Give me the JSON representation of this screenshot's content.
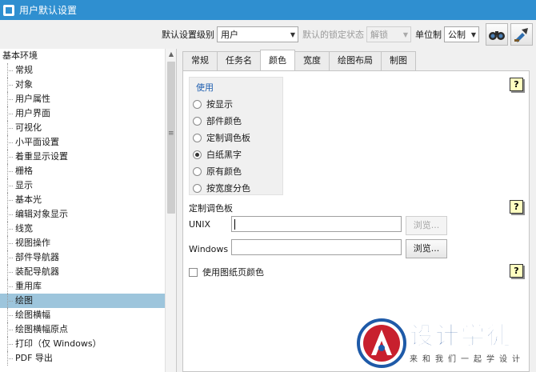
{
  "window": {
    "title": "用户默认设置"
  },
  "toolbar": {
    "level_label": "默认设置级别",
    "level_value": "用户",
    "lock_label": "默认的锁定状态",
    "lock_value": "解锁",
    "unit_label": "单位制",
    "unit_value": "公制",
    "buttons": [
      "binoculars-icon",
      "import-icon"
    ]
  },
  "tree": {
    "root": "基本环境",
    "items": [
      "常规",
      "对象",
      "用户属性",
      "用户界面",
      "可视化",
      "小平面设置",
      "着重显示设置",
      "栅格",
      "显示",
      "基本光",
      "编辑对象显示",
      "线宽",
      "视图操作",
      "部件导航器",
      "装配导航器",
      "重用库",
      "绘图",
      "绘图横幅",
      "绘图横幅原点",
      "打印（仅 Windows）",
      "PDF 导出"
    ],
    "selected": "绘图"
  },
  "tabs": [
    "常规",
    "任务名",
    "颜色",
    "宽度",
    "绘图布局",
    "制图"
  ],
  "active_tab": "颜色",
  "use_group": {
    "title": "使用",
    "options": [
      "按显示",
      "部件颜色",
      "定制调色板",
      "白纸黑字",
      "原有颜色",
      "按宽度分色"
    ],
    "selected": "白纸黑字"
  },
  "palette": {
    "title": "定制调色板",
    "unix_label": "UNIX",
    "unix_value": "",
    "windows_label": "Windows",
    "windows_value": "",
    "browse_label": "浏览..."
  },
  "checkbox": {
    "label": "使用图纸页颜色",
    "checked": false
  },
  "help_label": "?",
  "watermark": {
    "title": "设计学徒",
    "subtitle": "来和我们一起学设计"
  }
}
